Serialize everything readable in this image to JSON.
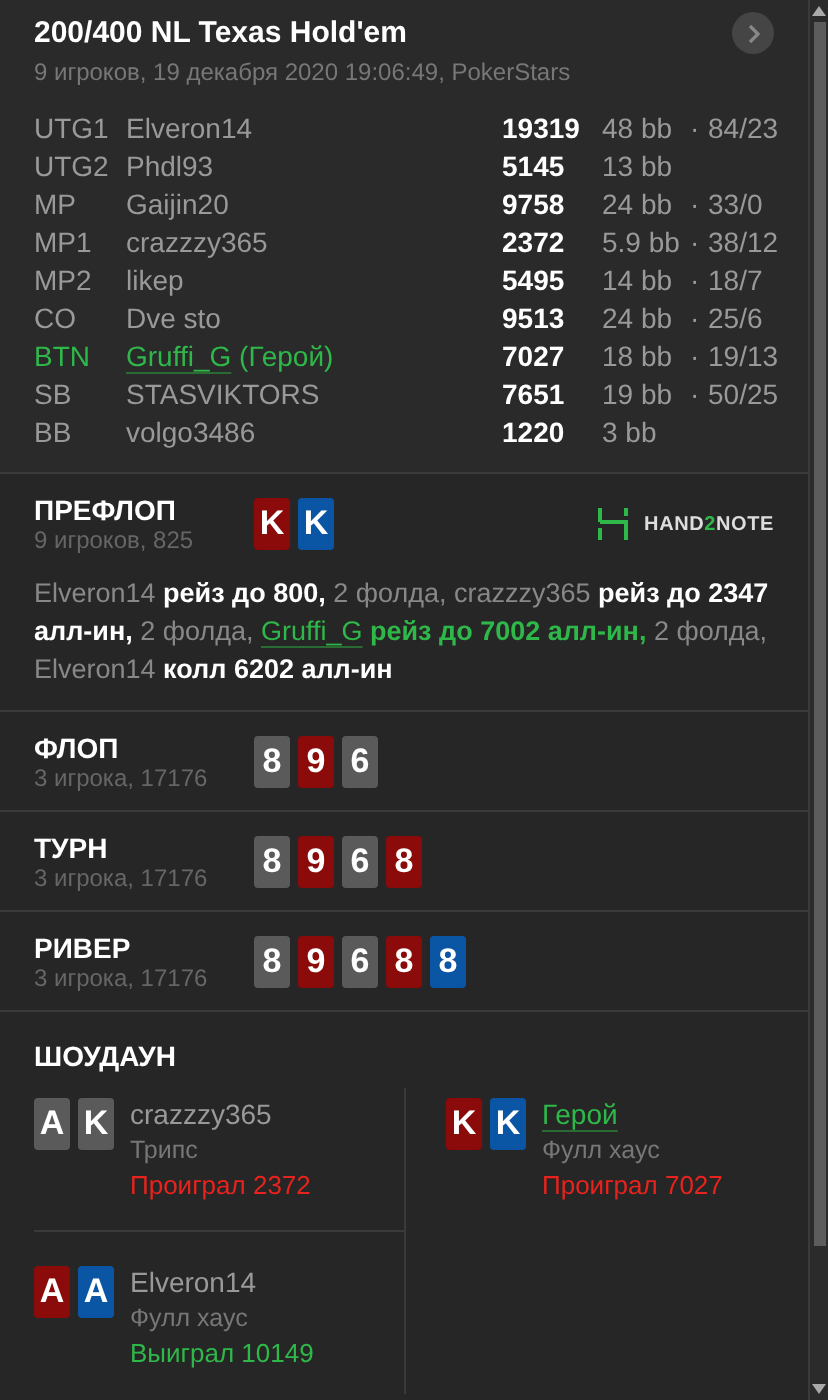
{
  "header": {
    "title": "200/400 NL Texas Hold'em",
    "subtitle": "9 игроков, 19 декабря 2020 19:06:49, PokerStars"
  },
  "players": [
    {
      "position": "UTG1",
      "name": "Elveron14",
      "stack": "19319",
      "bb": "48 bb",
      "dot": "·",
      "stats": "84/23",
      "hero": false
    },
    {
      "position": "UTG2",
      "name": "Phdl93",
      "stack": "5145",
      "bb": "13 bb",
      "hero": false
    },
    {
      "position": "MP",
      "name": "Gaijin20",
      "stack": "9758",
      "bb": "24 bb",
      "dot": "·",
      "stats": "33/0",
      "hero": false
    },
    {
      "position": "MP1",
      "name": "crazzzy365",
      "stack": "2372",
      "bb": "5.9 bb",
      "dot": "·",
      "stats": "38/12",
      "hero": false
    },
    {
      "position": "MP2",
      "name": "likep",
      "stack": "5495",
      "bb": "14 bb",
      "dot": "·",
      "stats": "18/7",
      "hero": false
    },
    {
      "position": "CO",
      "name": "Dve sto",
      "stack": "9513",
      "bb": "24 bb",
      "dot": "·",
      "stats": "25/6",
      "hero": false
    },
    {
      "position": "BTN",
      "name": "Gruffi_G",
      "tag": "(Герой)",
      "stack": "7027",
      "bb": "18 bb",
      "dot": "·",
      "stats": "19/13",
      "hero": true
    },
    {
      "position": "SB",
      "name": "STASVIKTORS",
      "stack": "7651",
      "bb": "19 bb",
      "dot": "·",
      "stats": "50/25",
      "hero": false
    },
    {
      "position": "BB",
      "name": "volgo3486",
      "stack": "1220",
      "bb": "3 bb",
      "hero": false
    }
  ],
  "streets": [
    {
      "title": "ПРЕФЛОП",
      "subtitle": "9 игроков, 825",
      "cards": [
        {
          "rank": "K",
          "color": "#8b0a0a"
        },
        {
          "rank": "K",
          "color": "#0b56a4"
        }
      ],
      "logo": [
        {
          "text": "HAND",
          "kind": "plain"
        },
        {
          "text": "2",
          "kind": "accent"
        },
        {
          "text": "NOTE",
          "kind": "plain"
        }
      ],
      "actions": [
        {
          "text": "Elveron14",
          "kind": "name"
        },
        {
          "text": " рейз до 800,",
          "kind": "action"
        },
        {
          "text": " 2 фолда, crazzzy365",
          "kind": "name"
        },
        {
          "text": " рейз до 2347 алл-ин,",
          "kind": "action"
        },
        {
          "text": " 2 фолда, ",
          "kind": "name"
        },
        {
          "text": "Gruffi_G",
          "kind": "hero-name"
        },
        {
          "text": " рейз до 7002 алл-ин,",
          "kind": "hero-action"
        },
        {
          "text": " 2 фолда, Elveron14",
          "kind": "name"
        },
        {
          "text": " колл 6202 алл-ин",
          "kind": "action"
        }
      ]
    },
    {
      "title": "ФЛОП",
      "subtitle": "3 игрока, 17176",
      "cards": [
        {
          "rank": "8",
          "color": "#5a5a5a"
        },
        {
          "rank": "9",
          "color": "#8b0a0a"
        },
        {
          "rank": "6",
          "color": "#5a5a5a"
        }
      ]
    },
    {
      "title": "ТУРН",
      "subtitle": "3 игрока, 17176",
      "cards": [
        {
          "rank": "8",
          "color": "#5a5a5a"
        },
        {
          "rank": "9",
          "color": "#8b0a0a"
        },
        {
          "rank": "6",
          "color": "#5a5a5a"
        },
        {
          "rank": "8",
          "color": "#8b0a0a"
        }
      ]
    },
    {
      "title": "РИВЕР",
      "subtitle": "3 игрока, 17176",
      "cards": [
        {
          "rank": "8",
          "color": "#5a5a5a"
        },
        {
          "rank": "9",
          "color": "#8b0a0a"
        },
        {
          "rank": "6",
          "color": "#5a5a5a"
        },
        {
          "rank": "8",
          "color": "#8b0a0a"
        },
        {
          "rank": "8",
          "color": "#0b56a4"
        }
      ]
    }
  ],
  "showdown": {
    "title": "ШОУДАУН",
    "hands": [
      {
        "name": "crazzzy365",
        "hero": false,
        "hand": "Трипс",
        "result": "Проиграл 2372",
        "won": false,
        "cards": [
          {
            "rank": "A",
            "color": "#5a5a5a"
          },
          {
            "rank": "K",
            "color": "#5a5a5a"
          }
        ]
      },
      {
        "name": "Герой",
        "hero": true,
        "hand": "Фулл хаус",
        "result": "Проиграл 7027",
        "won": false,
        "cards": [
          {
            "rank": "K",
            "color": "#8b0a0a"
          },
          {
            "rank": "K",
            "color": "#0b56a4"
          }
        ]
      },
      {
        "name": "Elveron14",
        "hero": false,
        "hand": "Фулл хаус",
        "result": "Выиграл 10149",
        "won": true,
        "cards": [
          {
            "rank": "A",
            "color": "#8b0a0a"
          },
          {
            "rank": "A",
            "color": "#0b56a4"
          }
        ]
      }
    ]
  }
}
